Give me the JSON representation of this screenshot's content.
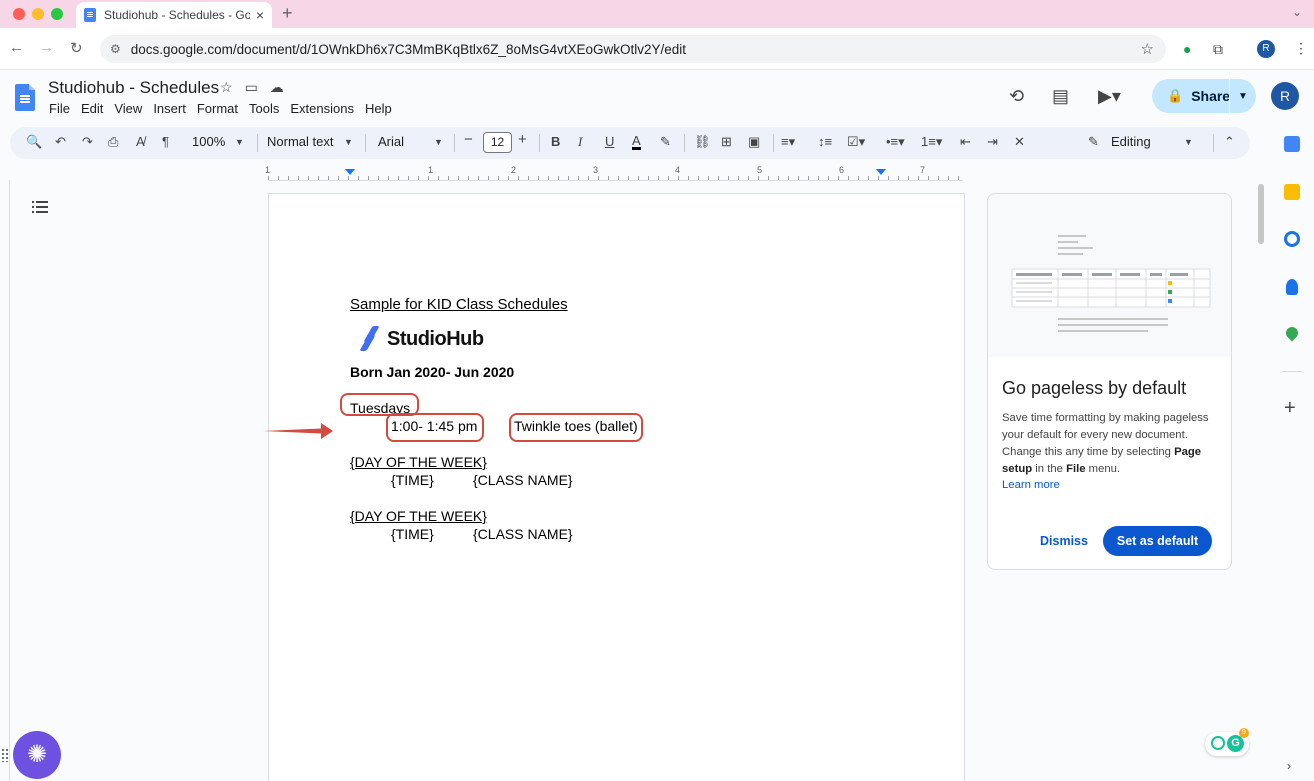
{
  "browser": {
    "tab_title": "Studiohub - Schedules - Goo",
    "url": "docs.google.com/document/d/1OWnkDh6x7C3MmBKqBtlx6Z_8oMsG4vtXEoGwkOtlv2Y/edit",
    "profile_initial": "R"
  },
  "docs": {
    "title": "Studiohub - Schedules",
    "menu": [
      "File",
      "Edit",
      "View",
      "Insert",
      "Format",
      "Tools",
      "Extensions",
      "Help"
    ],
    "share_label": "Share",
    "user_initial": "R",
    "toolbar": {
      "zoom": "100%",
      "style": "Normal text",
      "font": "Arial",
      "font_size": "12",
      "mode": "Editing"
    },
    "ruler_numbers": [
      "1",
      "1",
      "2",
      "3",
      "4",
      "5",
      "6",
      "7"
    ]
  },
  "document": {
    "heading": "Sample for KID Class Schedules",
    "logo_text": "StudioHub",
    "born_line": "Born Jan 2020- Jun 2020",
    "day1": "Tuesdays",
    "time1": "1:00- 1:45 pm",
    "class1": "Twinkle toes (ballet)",
    "day2": "{DAY OF THE WEEK}",
    "time2": "{TIME}",
    "class2": "{CLASS NAME}",
    "day3": "{DAY OF THE WEEK}",
    "time3": "{TIME}",
    "class3": "{CLASS NAME}"
  },
  "pageless_card": {
    "heading": "Go pageless by default",
    "desc_1": "Save time formatting by making pageless your default for every new document. Change this any time by selecting ",
    "desc_bold1": "Page setup",
    "desc_2": " in the ",
    "desc_bold2": "File",
    "desc_3": " menu.",
    "learn_more": "Learn more",
    "dismiss": "Dismiss",
    "set_default": "Set as default"
  },
  "grammarly_badge": "9",
  "colors": {
    "annotation": "#d24b3e",
    "share_bg": "#c2e7ff",
    "primary": "#0b57d0",
    "toolbar_bg": "#edf2fa"
  }
}
